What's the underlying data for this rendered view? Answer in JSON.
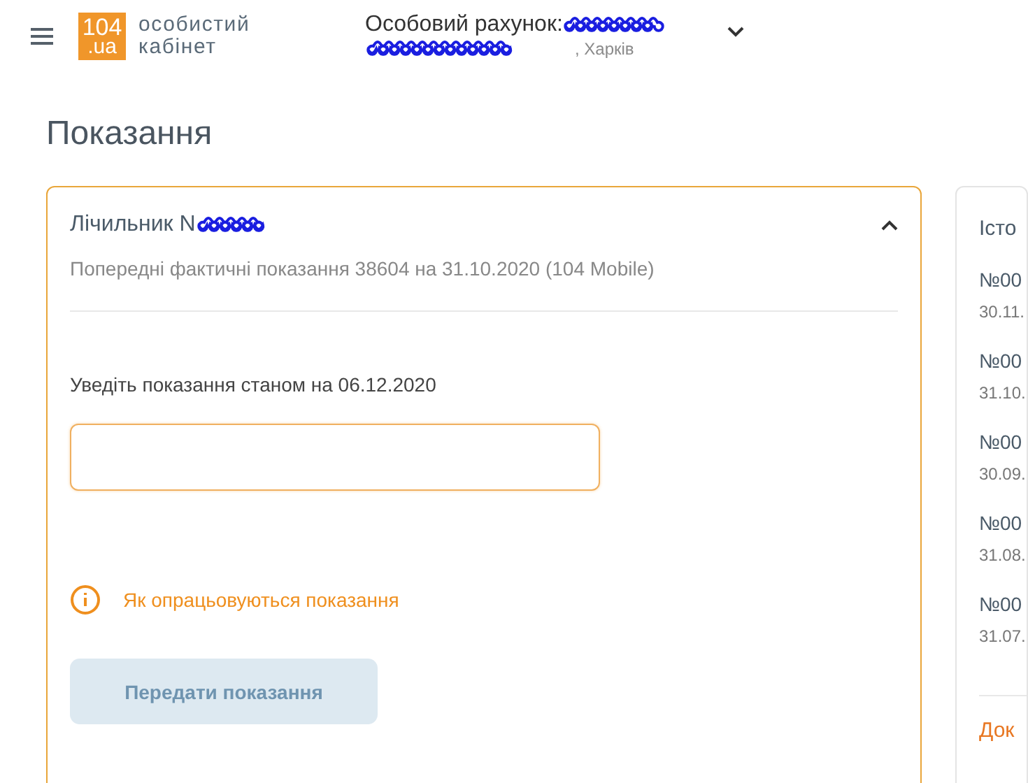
{
  "header": {
    "logo": {
      "number": "104",
      "domain": ".ua"
    },
    "brand": [
      "особистий",
      "кабінет"
    ],
    "account_label": "Особовий рахунок:",
    "city": ", Харків",
    "expanded": false
  },
  "page_title": "Показання",
  "meter_card": {
    "title": "Лічильник N",
    "expanded": true,
    "previous": "Попередні фактичні показання 38604 на 31.10.2020 (104 Mobile)",
    "input_label": "Уведіть показання станом на 06.12.2020",
    "field": {
      "focused": true
    },
    "info_link": "Як опрацьовуються показання",
    "submit": {
      "label": "Передати показання",
      "disabled": true
    }
  },
  "history": {
    "title": "Істо",
    "items": [
      {
        "number": "№00",
        "date": "30.11."
      },
      {
        "number": "№00",
        "date": "31.10."
      },
      {
        "number": "№00",
        "date": "30.09."
      },
      {
        "number": "№00",
        "date": "31.08."
      },
      {
        "number": "№00",
        "date": "31.07."
      }
    ],
    "link": "Док"
  }
}
